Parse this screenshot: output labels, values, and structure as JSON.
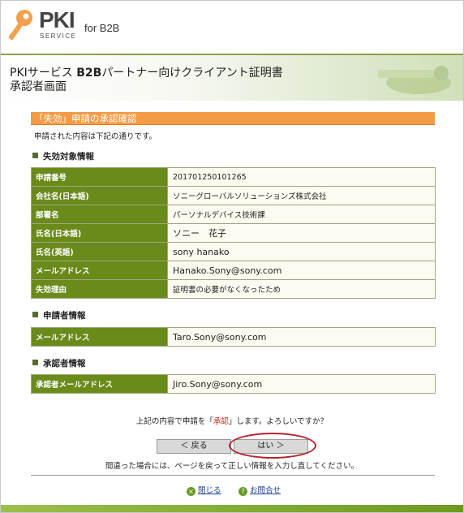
{
  "header": {
    "brand": "PKI",
    "brand_sub": "SERVICE",
    "product": "for B2B"
  },
  "title": {
    "line1_prefix": "PKIサービス",
    "line1_bold": "B2B",
    "line1_suffix": "パートナー向けクライアント証明書",
    "line2": "承認者画面"
  },
  "section": {
    "heading": "「失効」申請の承認確認",
    "intro": "申請された内容は下記の通りです。"
  },
  "revocation_info": {
    "heading": "失効対象情報",
    "rows": [
      {
        "label": "申請番号",
        "value": "201701250101265"
      },
      {
        "label": "会社名(日本語)",
        "value": "ソニーグローバルソリューションズ株式会社"
      },
      {
        "label": "部署名",
        "value": "パーソナルデバイス技術課"
      },
      {
        "label": "氏名(日本語)",
        "value": "ソニー　花子"
      },
      {
        "label": "氏名(英語)",
        "value": "sony hanako"
      },
      {
        "label": "メールアドレス",
        "value": "Hanako.Sony@sony.com"
      },
      {
        "label": "失効理由",
        "value": "証明書の必要がなくなったため"
      }
    ]
  },
  "applicant_info": {
    "heading": "申請者情報",
    "rows": [
      {
        "label": "メールアドレス",
        "value": "Taro.Sony@sony.com"
      }
    ]
  },
  "approver_info": {
    "heading": "承認者情報",
    "rows": [
      {
        "label": "承認者メールアドレス",
        "value": "Jiro.Sony@sony.com"
      }
    ]
  },
  "confirm": {
    "prefix": "上記の内容で申請を「",
    "highlight": "承認",
    "suffix": "」します。よろしいですか？",
    "back_label": "＜ 戻る",
    "yes_label": "はい ＞",
    "note": "間違った場合には、ページを戻って正しい情報を入力し直してください。"
  },
  "footer": {
    "close_label": "閉じる",
    "contact_label": "お問合せ"
  },
  "colors": {
    "accent_orange": "#f49b45",
    "label_green": "#6a8a1a",
    "highlight_red": "#d3201f"
  }
}
